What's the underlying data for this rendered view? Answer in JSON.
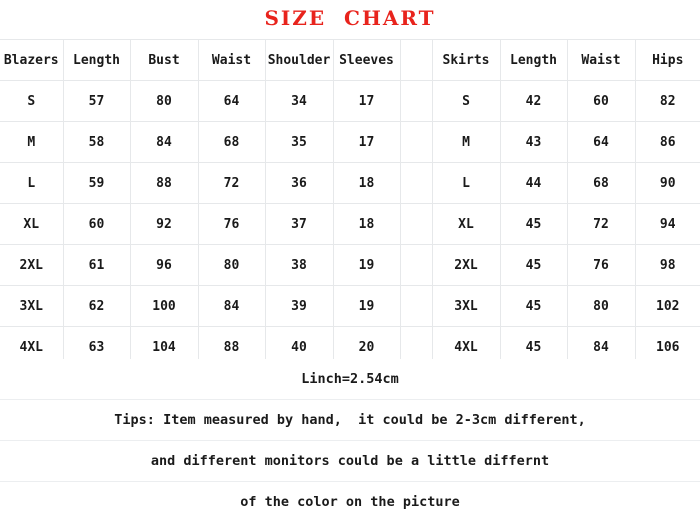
{
  "title": "SIZE  CHART",
  "title_color": "#e8231c",
  "grid_color": "#e6e8ea",
  "table": {
    "headers": {
      "blazers": "Blazers",
      "blazers_length": "Length",
      "blazers_bust": "Bust",
      "blazers_waist": "Waist",
      "blazers_shoulder": "Shoulder",
      "blazers_sleeves": "Sleeves",
      "spacer": "",
      "skirts": "Skirts",
      "skirts_length": "Length",
      "skirts_waist": "Waist",
      "skirts_hips": "Hips"
    },
    "rows": [
      {
        "blazer_size": "S",
        "blazer_length": "57",
        "blazer_bust": "80",
        "blazer_waist": "64",
        "blazer_shoulder": "34",
        "blazer_sleeves": "17",
        "spacer": "",
        "skirt_size": "S",
        "skirt_length": "42",
        "skirt_waist": "60",
        "skirt_hips": "82"
      },
      {
        "blazer_size": "M",
        "blazer_length": "58",
        "blazer_bust": "84",
        "blazer_waist": "68",
        "blazer_shoulder": "35",
        "blazer_sleeves": "17",
        "spacer": "",
        "skirt_size": "M",
        "skirt_length": "43",
        "skirt_waist": "64",
        "skirt_hips": "86"
      },
      {
        "blazer_size": "L",
        "blazer_length": "59",
        "blazer_bust": "88",
        "blazer_waist": "72",
        "blazer_shoulder": "36",
        "blazer_sleeves": "18",
        "spacer": "",
        "skirt_size": "L",
        "skirt_length": "44",
        "skirt_waist": "68",
        "skirt_hips": "90"
      },
      {
        "blazer_size": "XL",
        "blazer_length": "60",
        "blazer_bust": "92",
        "blazer_waist": "76",
        "blazer_shoulder": "37",
        "blazer_sleeves": "18",
        "spacer": "",
        "skirt_size": "XL",
        "skirt_length": "45",
        "skirt_waist": "72",
        "skirt_hips": "94"
      },
      {
        "blazer_size": "2XL",
        "blazer_length": "61",
        "blazer_bust": "96",
        "blazer_waist": "80",
        "blazer_shoulder": "38",
        "blazer_sleeves": "19",
        "spacer": "",
        "skirt_size": "2XL",
        "skirt_length": "45",
        "skirt_waist": "76",
        "skirt_hips": "98"
      },
      {
        "blazer_size": "3XL",
        "blazer_length": "62",
        "blazer_bust": "100",
        "blazer_waist": "84",
        "blazer_shoulder": "39",
        "blazer_sleeves": "19",
        "spacer": "",
        "skirt_size": "3XL",
        "skirt_length": "45",
        "skirt_waist": "80",
        "skirt_hips": "102"
      },
      {
        "blazer_size": "4XL",
        "blazer_length": "63",
        "blazer_bust": "104",
        "blazer_waist": "88",
        "blazer_shoulder": "40",
        "blazer_sleeves": "20",
        "spacer": "",
        "skirt_size": "4XL",
        "skirt_length": "45",
        "skirt_waist": "84",
        "skirt_hips": "106"
      }
    ]
  },
  "notes": {
    "unit_conversion": "Linch=2.54cm",
    "tips_line_1": "Tips: Item measured by hand,  it could be 2-3cm different,",
    "tips_line_2": "and different monitors could be a little differnt",
    "tips_line_3": "of the color on the picture"
  }
}
